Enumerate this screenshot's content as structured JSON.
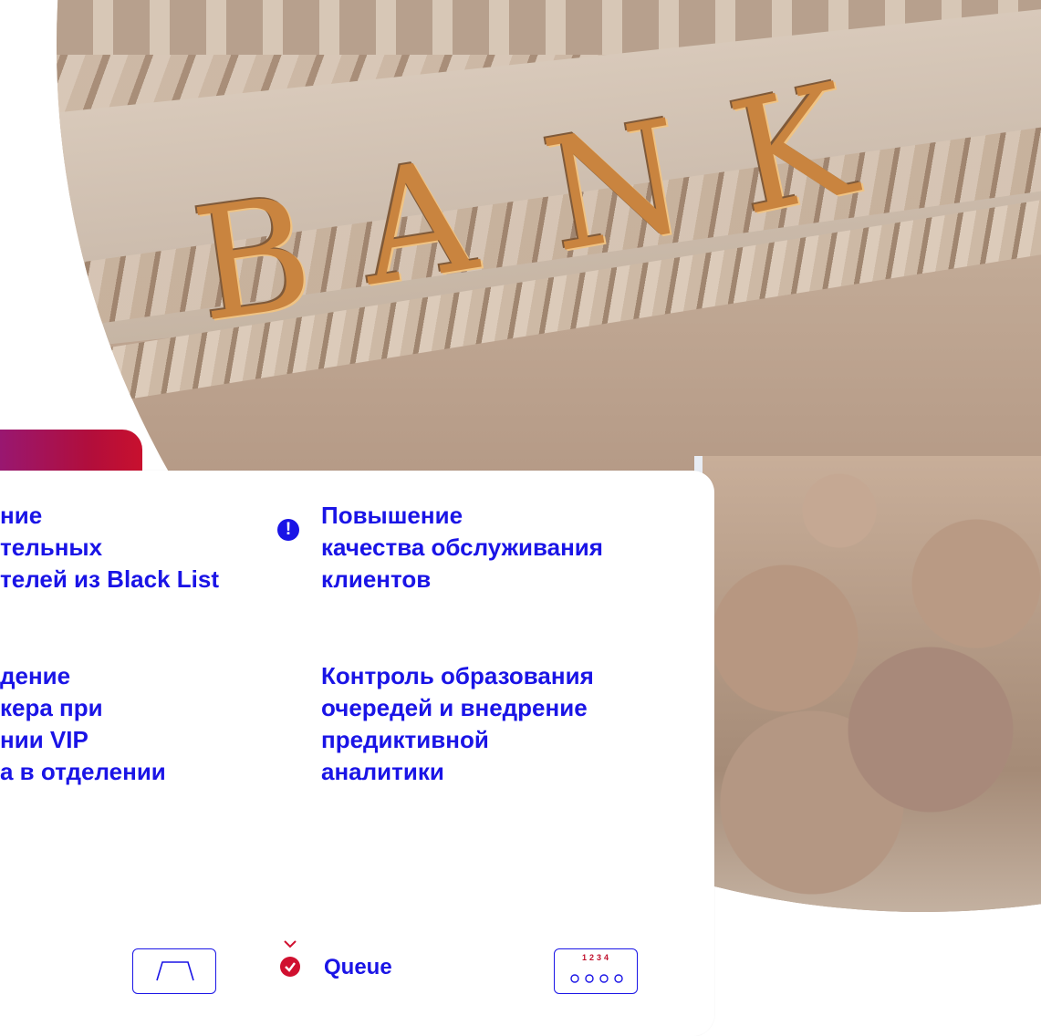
{
  "features": [
    {
      "lines": [
        "ние",
        "тельных",
        "телей из Black List"
      ]
    },
    {
      "lines": [
        "Повышение",
        "качества обслуживания",
        "клиентов"
      ]
    },
    {
      "lines": [
        "дение",
        "кера при",
        "нии VIP",
        "а в отделении"
      ]
    },
    {
      "lines": [
        "Контроль образования",
        "очередей и внедрение",
        "предиктивной",
        "аналитики"
      ]
    }
  ],
  "photo_sign": [
    "B",
    "A",
    "N",
    "K"
  ],
  "alert_icon": "!",
  "queue": {
    "label": "Queue",
    "icon": "check-circle-icon"
  },
  "queue_numbers": "1234",
  "colors": {
    "accent": "#1a14e6",
    "red": "#c8102e",
    "purple": "#8f1b86"
  }
}
